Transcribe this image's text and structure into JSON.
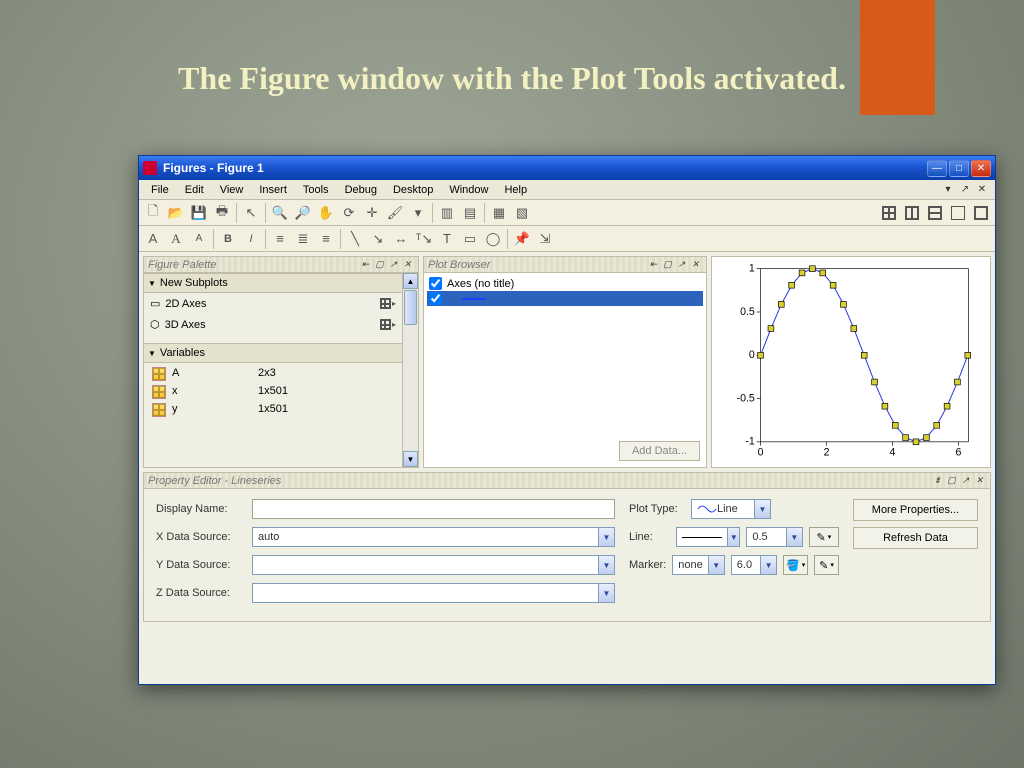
{
  "slide": {
    "title": "The Figure window with the Plot Tools activated."
  },
  "window": {
    "title": "Figures - Figure 1"
  },
  "menus": [
    "File",
    "Edit",
    "View",
    "Insert",
    "Tools",
    "Debug",
    "Desktop",
    "Window",
    "Help"
  ],
  "figure_palette": {
    "title": "Figure Palette",
    "section_subplots": "New Subplots",
    "item_2d": "2D Axes",
    "item_3d": "3D Axes",
    "section_vars": "Variables",
    "vars": [
      {
        "name": "A",
        "size": "2x3"
      },
      {
        "name": "x",
        "size": "1x501"
      },
      {
        "name": "y",
        "size": "1x501"
      }
    ]
  },
  "plot_browser": {
    "title": "Plot Browser",
    "axes_label": "Axes (no title)",
    "add_data": "Add Data..."
  },
  "property_editor": {
    "title": "Property Editor - Lineseries",
    "display_name_label": "Display Name:",
    "display_name": "",
    "plot_type_label": "Plot Type:",
    "plot_type": "Line",
    "x_src_label": "X Data Source:",
    "x_src": "auto",
    "y_src_label": "Y Data Source:",
    "y_src": "",
    "z_src_label": "Z Data Source:",
    "z_src": "",
    "line_label": "Line:",
    "line_width": "0.5",
    "marker_label": "Marker:",
    "marker": "none",
    "marker_size": "6.0",
    "more_props": "More Properties...",
    "refresh": "Refresh Data"
  },
  "chart_data": {
    "type": "line",
    "title": "",
    "xlabel": "",
    "ylabel": "",
    "xlim": [
      0,
      6.3
    ],
    "ylim": [
      -1,
      1
    ],
    "x_ticks": [
      0,
      2,
      4,
      6
    ],
    "y_ticks": [
      -1,
      -0.5,
      0,
      0.5,
      1
    ],
    "series": [
      {
        "name": "",
        "x_expr": "0:pi/10:2*pi",
        "y_expr": "sin(x)",
        "x": [
          0,
          0.314,
          0.628,
          0.942,
          1.257,
          1.571,
          1.885,
          2.199,
          2.513,
          2.827,
          3.142,
          3.456,
          3.77,
          4.084,
          4.398,
          4.712,
          5.027,
          5.341,
          5.655,
          5.969,
          6.283
        ],
        "y": [
          0,
          0.309,
          0.588,
          0.809,
          0.951,
          1.0,
          0.951,
          0.809,
          0.588,
          0.309,
          0,
          -0.309,
          -0.588,
          -0.809,
          -0.951,
          -1.0,
          -0.951,
          -0.809,
          -0.588,
          -0.309,
          0
        ],
        "line_color": "#2030e0",
        "marker": "square"
      }
    ]
  }
}
